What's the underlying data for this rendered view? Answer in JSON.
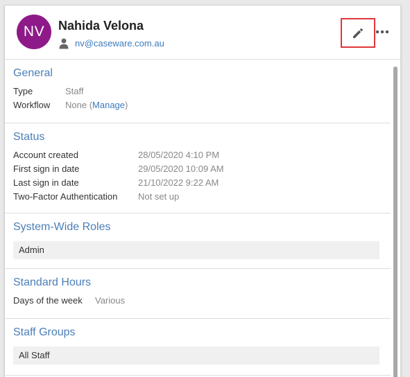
{
  "user": {
    "initials": "NV",
    "name": "Nahida Velona",
    "email": "nv@caseware.com.au",
    "avatar_color": "#8e1a89"
  },
  "actions": {
    "edit_icon": "pencil-icon",
    "more_icon": "more-horizontal-icon"
  },
  "general": {
    "title": "General",
    "rows": [
      {
        "label": "Type",
        "value": "Staff"
      },
      {
        "label": "Workflow",
        "value_prefix": "None (",
        "link": "Manage",
        "value_suffix": ")"
      }
    ]
  },
  "status": {
    "title": "Status",
    "rows": [
      {
        "label": "Account created",
        "value": "28/05/2020 4:10 PM"
      },
      {
        "label": "First sign in date",
        "value": "29/05/2020 10:09 AM"
      },
      {
        "label": "Last sign in date",
        "value": "21/10/2022 9:22 AM"
      },
      {
        "label": "Two-Factor Authentication",
        "value": "Not set up"
      }
    ]
  },
  "roles": {
    "title": "System-Wide Roles",
    "items": [
      "Admin"
    ]
  },
  "hours": {
    "title": "Standard Hours",
    "rows": [
      {
        "label": "Days of the week",
        "value": "Various"
      }
    ]
  },
  "groups": {
    "title": "Staff Groups",
    "items": [
      "All Staff"
    ]
  }
}
